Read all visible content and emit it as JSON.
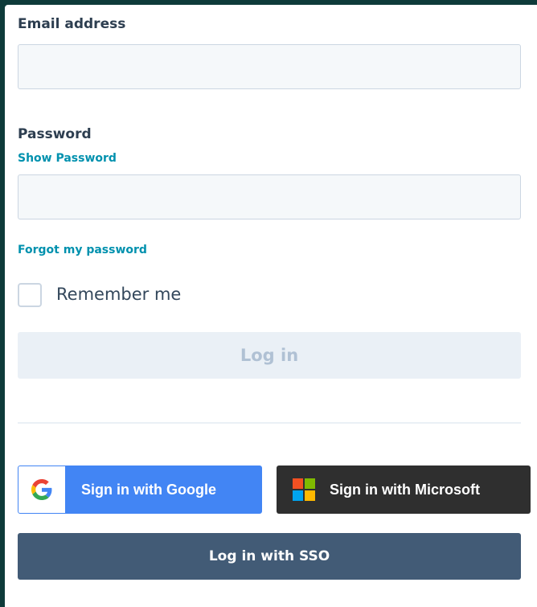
{
  "form": {
    "email_label": "Email address",
    "email_value": "",
    "password_label": "Password",
    "show_password_link": "Show Password",
    "password_value": "",
    "forgot_link": "Forgot my password",
    "remember_label": "Remember me",
    "remember_checked": false,
    "login_button": "Log in"
  },
  "sso": {
    "google_button": "Sign in with Google",
    "microsoft_button": "Sign in with Microsoft",
    "sso_button": "Log in with SSO"
  },
  "icons": {
    "google": "google-logo-icon",
    "microsoft": "microsoft-logo-icon"
  },
  "colors": {
    "background": "#0e3b3a",
    "link": "#0091ae",
    "label_text": "#2d3e50",
    "input_bg": "#f5f8fa",
    "input_border": "#cbd6e2",
    "login_disabled_bg": "#eaf0f6",
    "login_disabled_text": "#b0c1d4",
    "google_blue": "#4285f4",
    "microsoft_dark": "#2f2f2f",
    "sso_button": "#425b76"
  }
}
